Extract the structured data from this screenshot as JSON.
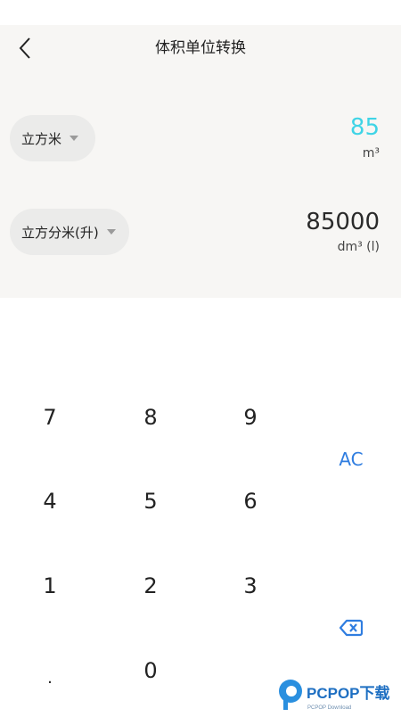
{
  "header": {
    "title": "体积单位转换"
  },
  "converter": {
    "from": {
      "unit_label": "立方米",
      "value": "85",
      "unit_symbol": "m³",
      "value_color": "#3fd4e6"
    },
    "to": {
      "unit_label": "立方分米(升)",
      "value": "85000",
      "unit_symbol": "dm³ (l)",
      "value_color": "#2a2a2a"
    }
  },
  "keypad": {
    "k7": "7",
    "k8": "8",
    "k9": "9",
    "k4": "4",
    "k5": "5",
    "k6": "6",
    "k1": "1",
    "k2": "2",
    "k3": "3",
    "kdot": ".",
    "k0": "0",
    "clear": "AC",
    "accent": "#2f7de0"
  },
  "watermark": {
    "brand": "PCPOP下载",
    "sub": "PCPOP Download"
  }
}
